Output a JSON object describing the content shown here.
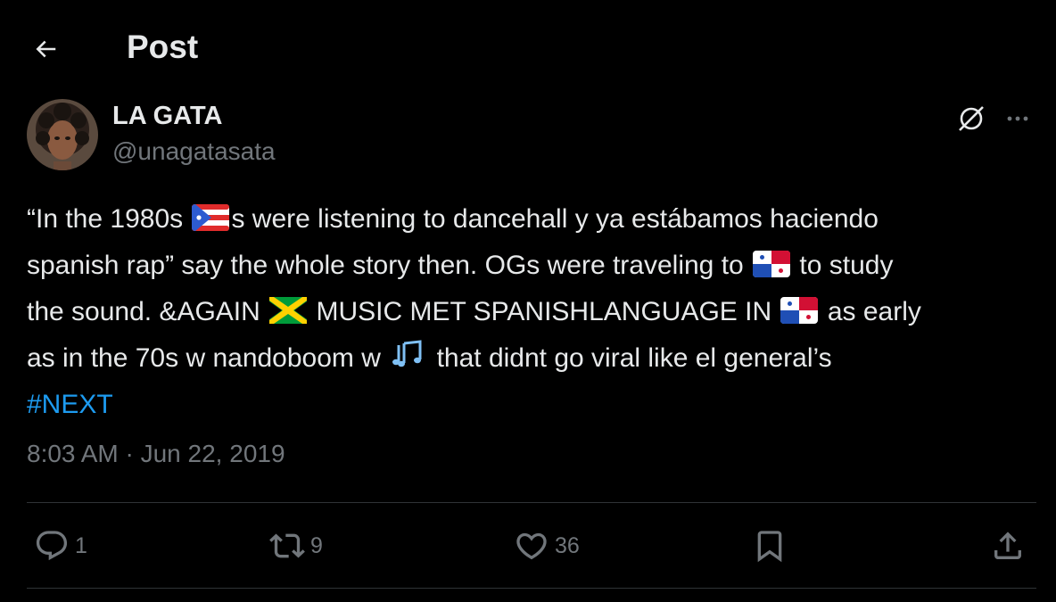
{
  "header": {
    "title": "Post"
  },
  "author": {
    "name": "LA GATA",
    "handle": "@unagatasata"
  },
  "post": {
    "line1_a": "“In the 1980s ",
    "line1_flag": "Puerto Rico flag",
    "line1_b": "s were listening to dancehall y ya estábamos haciendo",
    "line2_a": "spanish rap” say the whole story then. OGs were traveling to ",
    "line2_flag": "Panama flag",
    "line2_b": " to study",
    "line3_a": "the sound.  &AGAIN ",
    "line3_flag1": "Jamaica flag",
    "line3_b": " MUSIC MET SPANISHLANGUAGE IN ",
    "line3_flag2": "Panama flag",
    "line3_c": " as early",
    "line4_a": "as in the 70s w nandoboom w ",
    "line4_emoji": "musical notes",
    "line4_b": " that didnt go viral like el general’s",
    "hashtag": "#NEXT"
  },
  "timestamp": "8:03 AM · Jun 22, 2019",
  "actions": {
    "reply_count": "1",
    "repost_count": "9",
    "like_count": "36"
  },
  "icons": [
    "back-arrow-icon",
    "grok-icon",
    "more-icon",
    "reply-icon",
    "repost-icon",
    "like-icon",
    "bookmark-icon",
    "share-icon"
  ],
  "colors": {
    "background": "#000000",
    "text": "#e7e9ea",
    "secondary": "#71767b",
    "link": "#1d9bf0",
    "divider": "#2f3336"
  }
}
